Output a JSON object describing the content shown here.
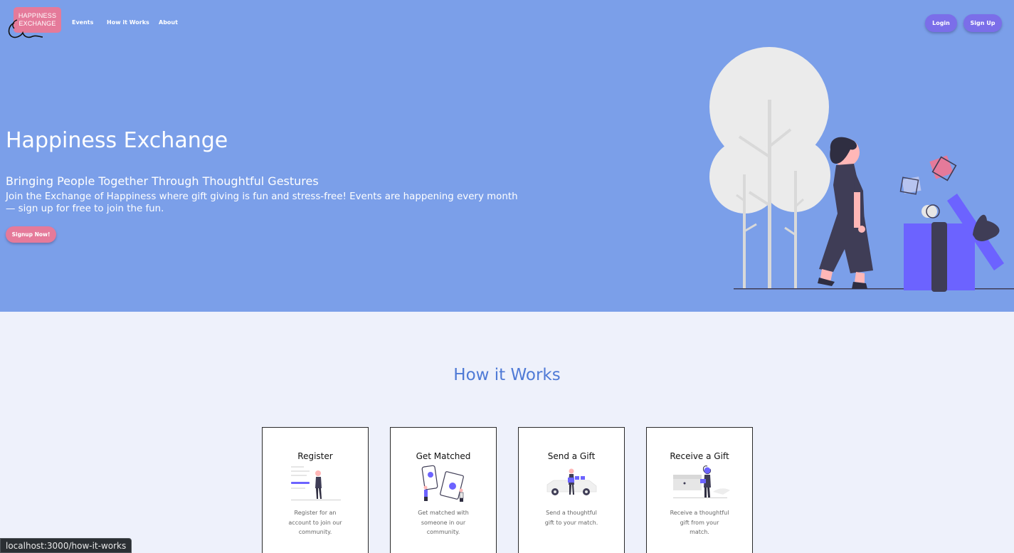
{
  "brand": {
    "logo_line1": "HAPPINESS",
    "logo_line2": "EXCHANGE",
    "color": "#e57a9a"
  },
  "nav": {
    "links": [
      {
        "label": "Events"
      },
      {
        "label": "How it Works"
      },
      {
        "label": "About"
      }
    ],
    "login_label": "Login",
    "signup_label": "Sign Up"
  },
  "hero": {
    "title": "Happiness Exchange",
    "subtitle": "Bringing People Together Through Thoughtful Gestures",
    "description": "Join the Exchange of Happiness where gift giving is fun and stress-free! Events are happening every month — sign up for free to join the fun.",
    "cta_label": "Signup Now!",
    "background": "#7b9fe9"
  },
  "how_it_works": {
    "title": "How it Works",
    "steps": [
      {
        "title": "Register",
        "description": "Register for an account to join our community.",
        "icon": "register-illustration-icon"
      },
      {
        "title": "Get Matched",
        "description": "Get matched with someone in our community.",
        "icon": "matched-illustration-icon"
      },
      {
        "title": "Send a Gift",
        "description": "Send a thoughtful gift to your match.",
        "icon": "send-gift-illustration-icon"
      },
      {
        "title": "Receive a Gift",
        "description": "Receive a thoughtful gift from your match.",
        "icon": "receive-gift-illustration-icon"
      }
    ]
  },
  "status_bar": {
    "url": "localhost:3000/how-it-works"
  },
  "colors": {
    "accent": "#7b6ee9",
    "heading": "#4f7ad6",
    "page_bg": "#eef1fb"
  }
}
